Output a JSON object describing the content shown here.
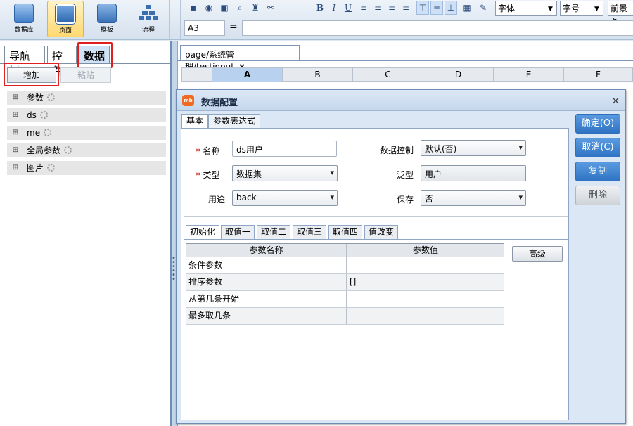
{
  "topbar": {
    "buttons": [
      {
        "label": "数据库",
        "icon": "database-icon"
      },
      {
        "label": "页面",
        "icon": "page-icon"
      },
      {
        "label": "模板",
        "icon": "template-icon"
      },
      {
        "label": "流程",
        "icon": "flow-icon"
      }
    ]
  },
  "toolbar": {
    "bold": "B",
    "italic": "I",
    "underline": "U",
    "font_select": "字体",
    "size_select": "字号",
    "fg_select": "前景色"
  },
  "formula_bar": {
    "cell_ref": "A3",
    "equals": "=",
    "formula": ""
  },
  "left_panel": {
    "tabs": [
      "导航树",
      "控件",
      "数据"
    ],
    "active_tab": "数据",
    "add_button": "增加",
    "paste_button": "粘贴",
    "tree": [
      "参数",
      "ds",
      "me",
      "全局参数",
      "图片"
    ]
  },
  "editor": {
    "page_tab": "page/系统管理/testinput",
    "close": "×",
    "columns": [
      "A",
      "B",
      "C",
      "D",
      "E",
      "F"
    ]
  },
  "dialog": {
    "title": "数据配置",
    "icon_text": "mb",
    "close": "×",
    "tabs": [
      "基本",
      "参数表达式"
    ],
    "required_mark": "*",
    "fields": {
      "name_label": "名称",
      "name_value": "ds用户",
      "type_label": "类型",
      "type_value": "数据集",
      "usage_label": "用途",
      "usage_value": "back",
      "control_label": "数据控制",
      "control_value": "默认(否)",
      "generic_label": "泛型",
      "generic_value": "用户",
      "save_label": "保存",
      "save_value": "否"
    },
    "sub_tabs": [
      "初始化",
      "取值一",
      "取值二",
      "取值三",
      "取值四",
      "值改变"
    ],
    "table": {
      "headers": [
        "参数名称",
        "参数值"
      ],
      "rows": [
        [
          "条件参数",
          ""
        ],
        [
          "排序参数",
          "[]"
        ],
        [
          "从第几条开始",
          ""
        ],
        [
          "最多取几条",
          ""
        ]
      ]
    },
    "advanced_button": "高级",
    "side_buttons": [
      "确定(O)",
      "取消(C)",
      "复制",
      "删除"
    ]
  }
}
